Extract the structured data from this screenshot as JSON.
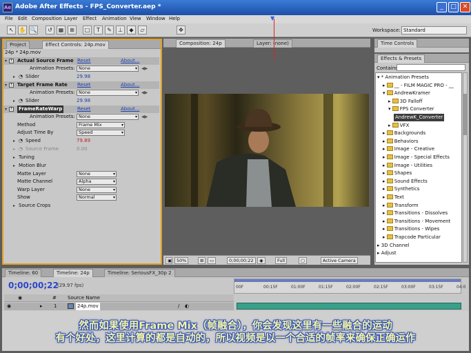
{
  "window": {
    "app_icon": "Ae",
    "title": "Adobe After Effects - FPS_Converter.aep *",
    "minimize": "_",
    "maximize": "□",
    "close": "✕"
  },
  "menu": [
    "File",
    "Edit",
    "Composition",
    "Layer",
    "Effect",
    "Animation",
    "View",
    "Window",
    "Help"
  ],
  "toolbar": {
    "tools": [
      "↖",
      "✋",
      "🔍",
      "↺",
      "▦",
      "⊞",
      "□",
      "T",
      "✎",
      "⊥",
      "◆",
      "▱",
      "✥"
    ],
    "workspace_label": "Workspace:",
    "workspace_value": "Standard"
  },
  "effect_controls": {
    "tabs": [
      "Project",
      "Effect Controls: 24p.mov"
    ],
    "subtitle": "24p * 24p.mov",
    "reset": "Reset",
    "about": "About...",
    "preset_label": "Animation Presets:",
    "preset_value": "None",
    "effects": [
      {
        "name": "Actual Source Frame",
        "slider_label": "Slider",
        "slider_value": "29.98"
      },
      {
        "name": "Target Frame Rate",
        "slider_label": "Slider",
        "slider_value": "29.98"
      }
    ],
    "framerate_warp": {
      "name": "FrameRateWarp",
      "method_label": "Method",
      "method_value": "Frame Mix",
      "adjust_label": "Adjust Time By",
      "adjust_value": "Speed",
      "speed_label": "Speed",
      "speed_value": "79.89",
      "source_frame_label": "Source Frame",
      "source_frame_value": "0.00",
      "tuning_label": "Tuning",
      "motion_blur_label": "Motion Blur",
      "matte_layer_label": "Matte Layer",
      "matte_layer_value": "None",
      "matte_channel_label": "Matte Channel",
      "matte_channel_value": "Alpha",
      "warp_layer_label": "Warp Layer",
      "warp_layer_value": "None",
      "show_label": "Show",
      "show_value": "Normal",
      "source_crops_label": "Source Crops"
    }
  },
  "composition": {
    "tab_comp": "Composition: 24p",
    "tab_layer": "Layer: (none)",
    "zoom": "50%",
    "timecode": "0;00;00;22",
    "resolution": "Full",
    "camera": "Active Camera"
  },
  "time_controls": {
    "tab": "Time Controls"
  },
  "effects_presets": {
    "tab": "Effects & Presets",
    "contains_label": "Contains:",
    "tree": [
      {
        "label": "* Animation Presets",
        "indent": 0,
        "tri": "▾",
        "folder": false
      },
      {
        "label": "__ - FILM MAGIC PRO - __",
        "indent": 1,
        "tri": "▸",
        "folder": true
      },
      {
        "label": "AndrewKramer",
        "indent": 1,
        "tri": "▾",
        "folder": true
      },
      {
        "label": "3D Falloff",
        "indent": 2,
        "tri": "▸",
        "folder": true
      },
      {
        "label": "FPS Converter",
        "indent": 2,
        "tri": "▾",
        "folder": true
      },
      {
        "label": "AndrewK_Converter",
        "indent": 3,
        "tri": "",
        "folder": false,
        "selected": true
      },
      {
        "label": "VFX",
        "indent": 2,
        "tri": "▸",
        "folder": true
      },
      {
        "label": "Backgrounds",
        "indent": 1,
        "tri": "▸",
        "folder": true
      },
      {
        "label": "Behaviors",
        "indent": 1,
        "tri": "▸",
        "folder": true
      },
      {
        "label": "Image - Creative",
        "indent": 1,
        "tri": "▸",
        "folder": true
      },
      {
        "label": "Image - Special Effects",
        "indent": 1,
        "tri": "▸",
        "folder": true
      },
      {
        "label": "Image - Utilities",
        "indent": 1,
        "tri": "▸",
        "folder": true
      },
      {
        "label": "Shapes",
        "indent": 1,
        "tri": "▸",
        "folder": true
      },
      {
        "label": "Sound Effects",
        "indent": 1,
        "tri": "▸",
        "folder": true
      },
      {
        "label": "Synthetics",
        "indent": 1,
        "tri": "▸",
        "folder": true
      },
      {
        "label": "Text",
        "indent": 1,
        "tri": "▸",
        "folder": true
      },
      {
        "label": "Transform",
        "indent": 1,
        "tri": "▸",
        "folder": true
      },
      {
        "label": "Transitions - Dissolves",
        "indent": 1,
        "tri": "▸",
        "folder": true
      },
      {
        "label": "Transitions - Movement",
        "indent": 1,
        "tri": "▸",
        "folder": true
      },
      {
        "label": "Transitions - Wipes",
        "indent": 1,
        "tri": "▸",
        "folder": true
      },
      {
        "label": "Trapcode Particular",
        "indent": 1,
        "tri": "▸",
        "folder": true
      },
      {
        "label": "3D Channel",
        "indent": 0,
        "tri": "▸",
        "folder": false
      },
      {
        "label": "Adjust",
        "indent": 0,
        "tri": "▸",
        "folder": false
      }
    ]
  },
  "timeline": {
    "tabs": [
      "Timeline: 60",
      "Timeline: 24p",
      "Timeline: SeriousFX_30p 2"
    ],
    "timecode": "0;00;00;22",
    "fps": "(29.97 fps)",
    "col_num": "#",
    "col_source": "Source Name",
    "layer_num": "1",
    "layer_name": "24p.mov",
    "ticks": [
      "00F",
      "00:15F",
      "01:00F",
      "01:15F",
      "02:00F",
      "02:15F",
      "03:00F",
      "03:15F",
      "04:0"
    ]
  },
  "subtitles": {
    "line1": "然而如果使用Frame Mix（帧融合），你会发现这里有一些融合的运动",
    "line2": "有个好处，这里计算的都是自动的，所以视频是以一个合适的帧率来确保正确运作"
  }
}
